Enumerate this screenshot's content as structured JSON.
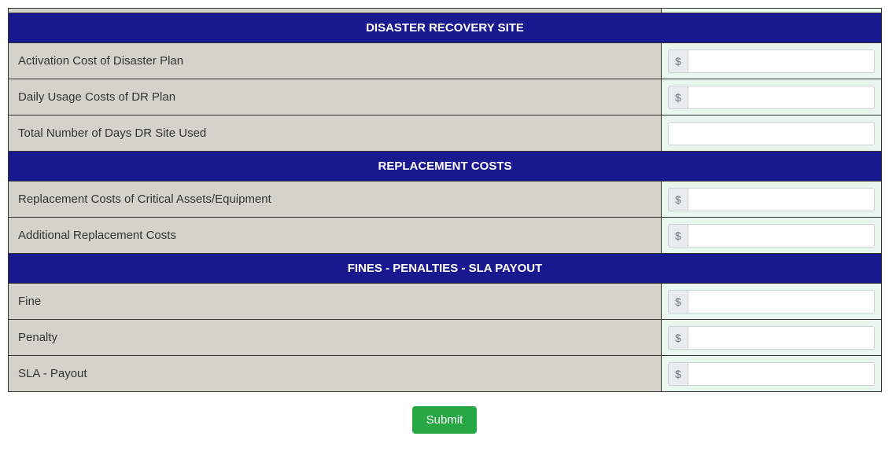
{
  "currency_symbol": "$",
  "sections": {
    "dr": {
      "title": "DISASTER RECOVERY SITE",
      "rows": {
        "activation": {
          "label": "Activation Cost of Disaster Plan",
          "prefix": true,
          "value": ""
        },
        "daily": {
          "label": "Daily Usage Costs of DR Plan",
          "prefix": true,
          "value": ""
        },
        "days": {
          "label": "Total Number of Days DR Site Used",
          "prefix": false,
          "value": ""
        }
      }
    },
    "replacement": {
      "title": "REPLACEMENT COSTS",
      "rows": {
        "critical": {
          "label": "Replacement Costs of Critical Assets/Equipment",
          "prefix": true,
          "value": ""
        },
        "additional": {
          "label": "Additional Replacement Costs",
          "prefix": true,
          "value": ""
        }
      }
    },
    "fines": {
      "title": "FINES - PENALTIES - SLA PAYOUT",
      "rows": {
        "fine": {
          "label": "Fine",
          "prefix": true,
          "value": ""
        },
        "penalty": {
          "label": "Penalty",
          "prefix": true,
          "value": ""
        },
        "sla": {
          "label": "SLA - Payout",
          "prefix": true,
          "value": ""
        }
      }
    }
  },
  "submit_label": "Submit"
}
